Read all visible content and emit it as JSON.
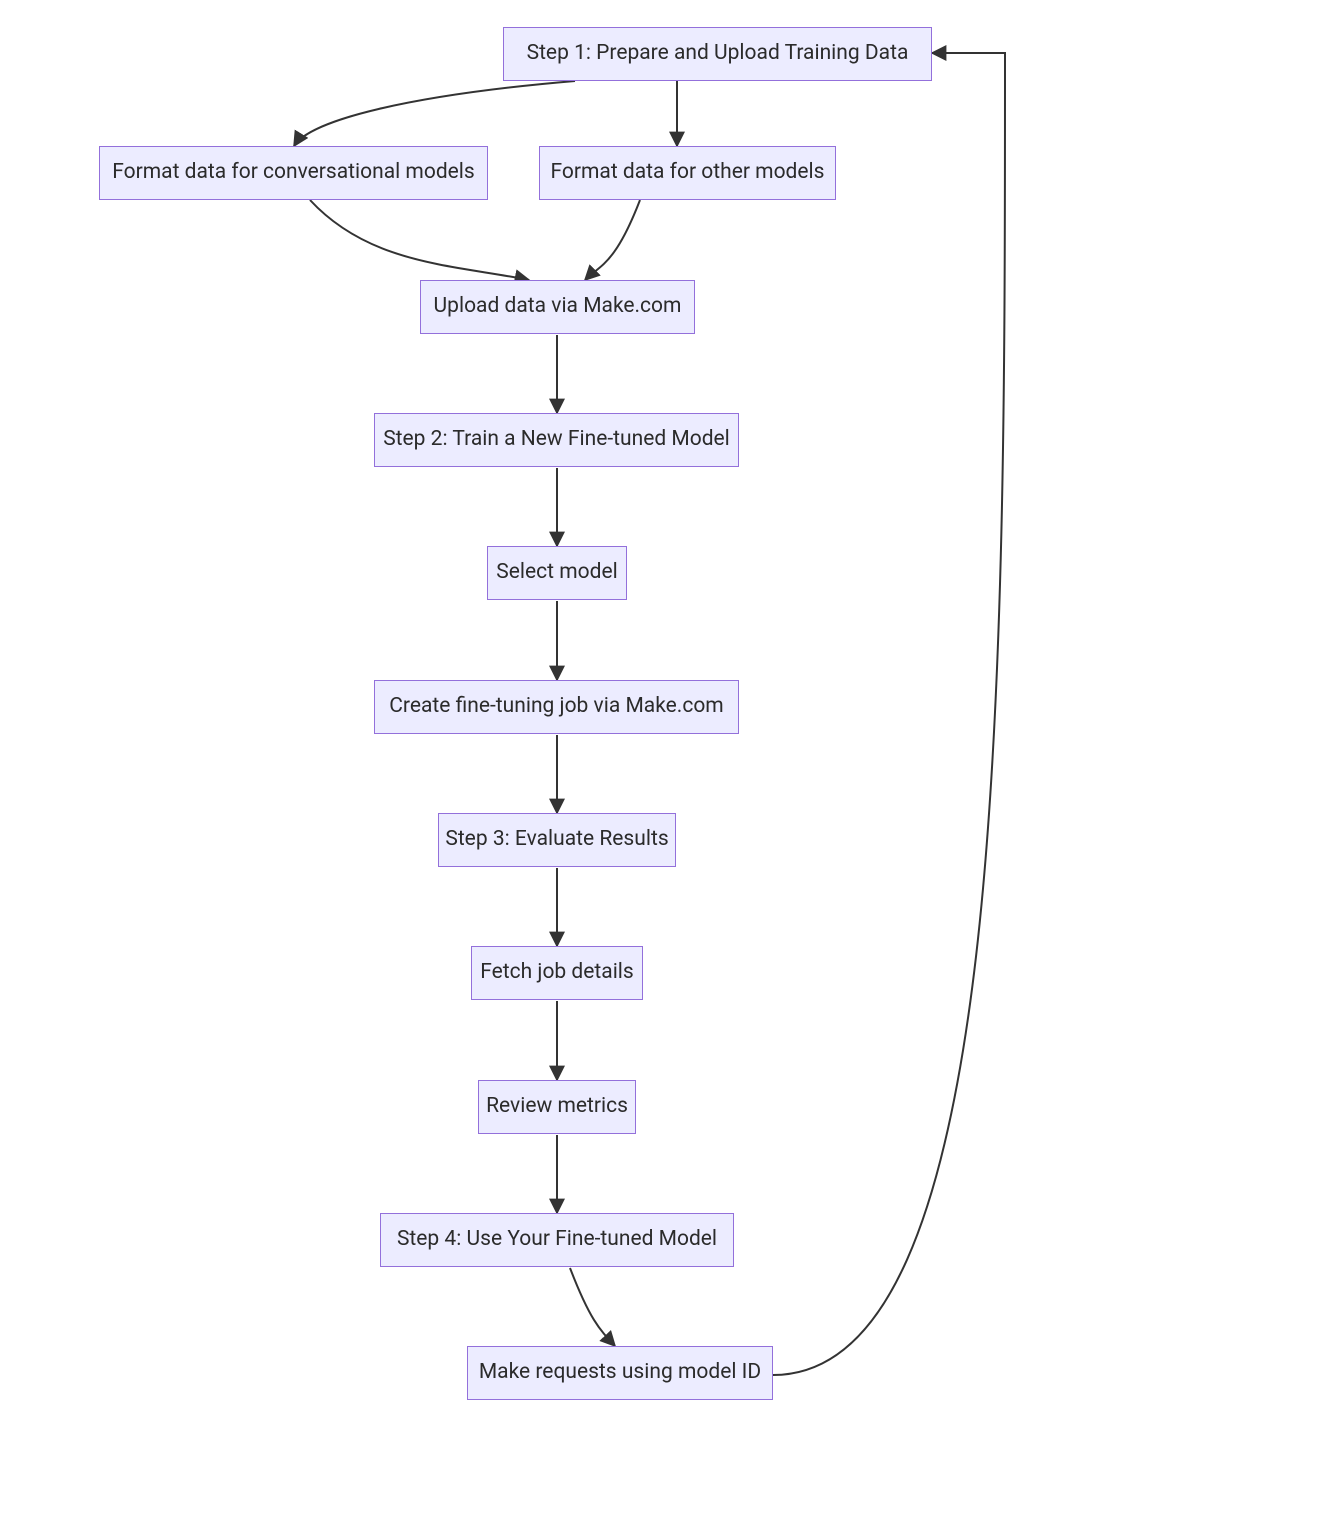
{
  "diagram": {
    "nodes": {
      "step1": {
        "label": "Step 1: Prepare and Upload Training Data"
      },
      "fmtConv": {
        "label": "Format data for conversational models"
      },
      "fmtOther": {
        "label": "Format data for other models"
      },
      "upload": {
        "label": "Upload data via Make.com"
      },
      "step2": {
        "label": "Step 2: Train a New Fine-tuned Model"
      },
      "select": {
        "label": "Select model"
      },
      "createJob": {
        "label": "Create fine-tuning job via Make.com"
      },
      "step3": {
        "label": "Step 3: Evaluate Results"
      },
      "fetch": {
        "label": "Fetch job details"
      },
      "review": {
        "label": "Review metrics"
      },
      "step4": {
        "label": "Step 4: Use Your Fine-tuned Model"
      },
      "makeReq": {
        "label": "Make requests using model ID"
      }
    },
    "edges": [
      {
        "from": "step1",
        "to": "fmtConv"
      },
      {
        "from": "step1",
        "to": "fmtOther"
      },
      {
        "from": "fmtConv",
        "to": "upload"
      },
      {
        "from": "fmtOther",
        "to": "upload"
      },
      {
        "from": "upload",
        "to": "step2"
      },
      {
        "from": "step2",
        "to": "select"
      },
      {
        "from": "select",
        "to": "createJob"
      },
      {
        "from": "createJob",
        "to": "step3"
      },
      {
        "from": "step3",
        "to": "fetch"
      },
      {
        "from": "fetch",
        "to": "review"
      },
      {
        "from": "review",
        "to": "step4"
      },
      {
        "from": "step4",
        "to": "makeReq"
      },
      {
        "from": "makeReq",
        "to": "step1"
      }
    ]
  }
}
